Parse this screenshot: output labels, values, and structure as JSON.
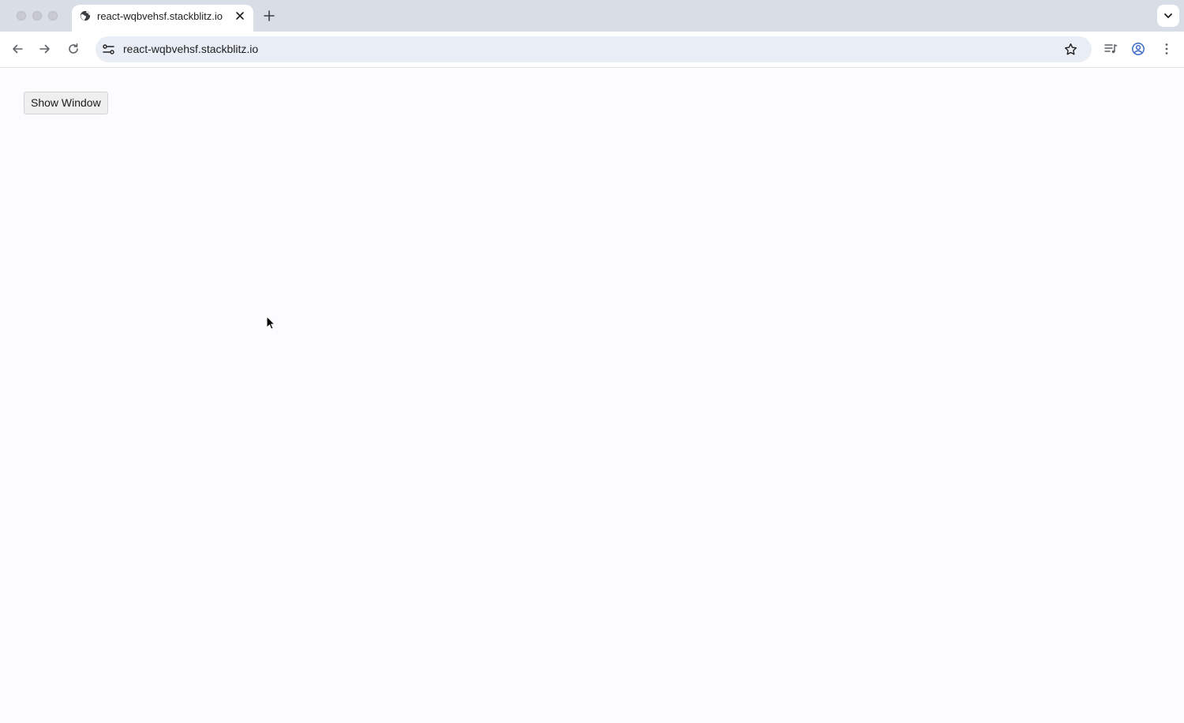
{
  "browser": {
    "tab": {
      "title": "react-wqbvehsf.stackblitz.io"
    },
    "omnibox": {
      "url": "react-wqbvehsf.stackblitz.io"
    }
  },
  "page": {
    "show_window_button": "Show Window"
  },
  "icons": {
    "favicon": "globe-icon",
    "tab_close": "close-icon",
    "new_tab": "plus-icon",
    "tab_search": "chevron-down-icon",
    "back": "arrow-left-icon",
    "forward": "arrow-right-icon",
    "reload": "reload-icon",
    "site_info": "tune-icon",
    "bookmark": "star-icon",
    "media": "media-controls-icon",
    "profile": "account-icon",
    "menu": "kebab-menu-icon"
  },
  "colors": {
    "tabstrip": "#d9dde5",
    "omnibox": "#e9eef6",
    "page_background": "#fcfbfd"
  }
}
